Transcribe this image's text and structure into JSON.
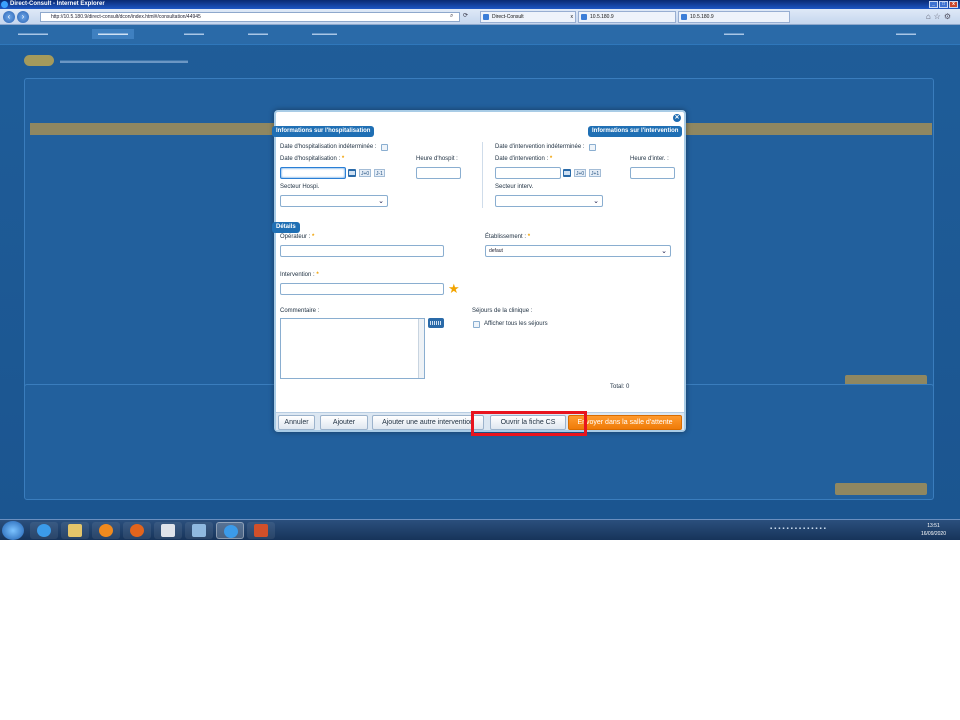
{
  "browser": {
    "title": "Direct-Consult - Internet Explorer",
    "url": "http://10.5.180.9/direct-consult/dcon/index.html#/consultation/44945",
    "tabs": [
      {
        "label": "Direct-Consult"
      },
      {
        "label": "10.5.180.9"
      },
      {
        "label": "10.5.180.9"
      }
    ]
  },
  "modal": {
    "hosp_section": {
      "title": "Informations sur l'hospitalisation",
      "undetermined_label": "Date d'hospitalisation indéterminée :",
      "date_label": "Date d'hospitalisation :",
      "hour_label": "Heure d'hospit :",
      "sector_label": "Secteur Hospi.",
      "j0": "J+0",
      "j1": "J-1"
    },
    "interv_section": {
      "title": "Informations sur l'intervention",
      "undetermined_label": "Date d'intervention indéterminée :",
      "date_label": "Date d'intervention :",
      "hour_label": "Heure d'inter. :",
      "sector_label": "Secteur interv.",
      "j0": "J+0",
      "j1": "J+1"
    },
    "details": {
      "title": "Détails",
      "operator_label": "Opérateur :",
      "establishment_label": "Établissement :",
      "establishment_value": "defaut",
      "intervention_label": "Intervention :",
      "comment_label": "Commentaire :",
      "stays_label": "Séjours de la clinique :",
      "show_all_stays_label": "Afficher tous les séjours",
      "total_label": "Total: 0"
    },
    "asterisk": "*",
    "buttons": {
      "cancel": "Annuler",
      "add": "Ajouter",
      "add_another": "Ajouter une autre intervention",
      "open_cs": "Ouvrir la fiche CS",
      "send_waiting": "Envoyer dans la salle d'attente"
    }
  },
  "taskbar": {
    "time": "13:51",
    "date": "16/09/2020"
  },
  "colors": {
    "accent": "#1f6fb4",
    "primary_button": "#ef7b08",
    "highlight_box": "#e8141e"
  }
}
